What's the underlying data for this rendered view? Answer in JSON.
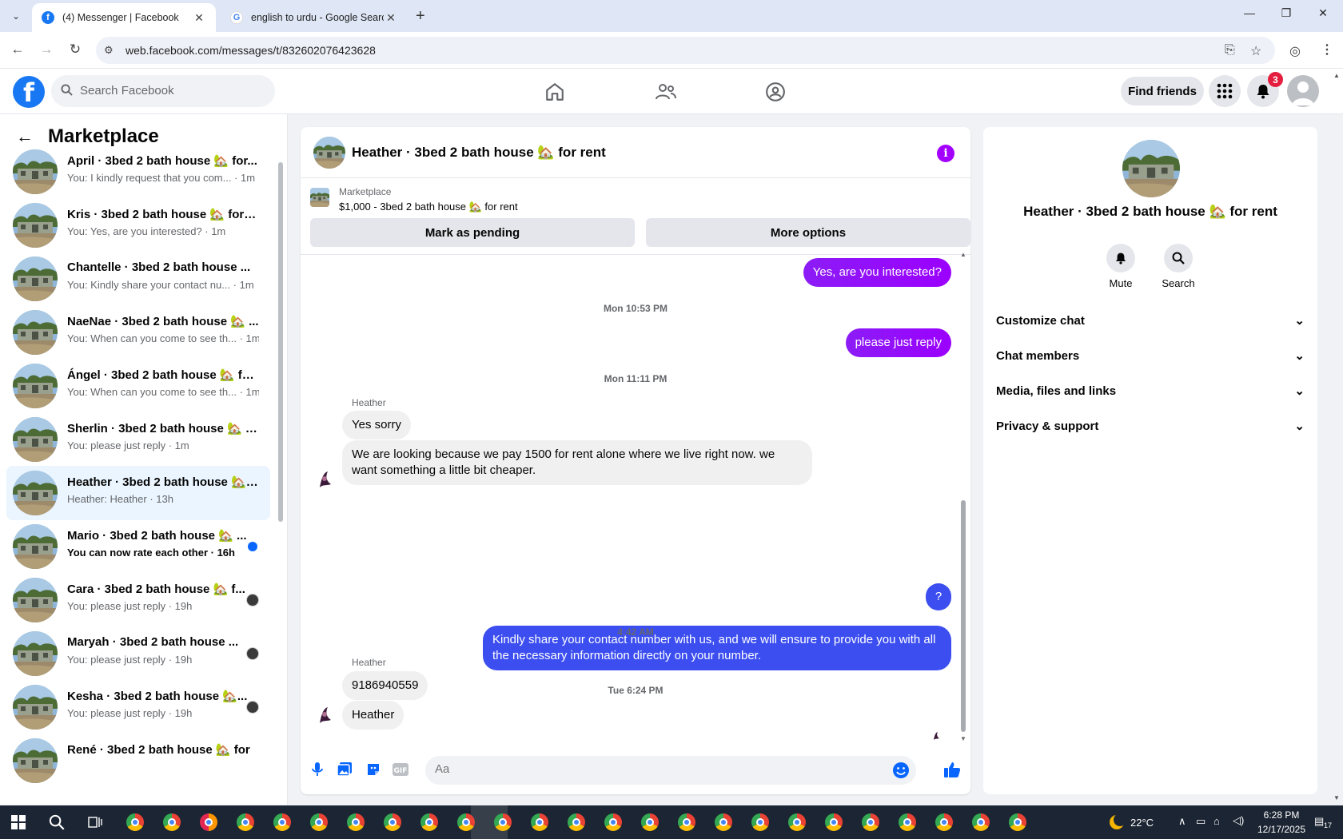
{
  "browser": {
    "tabs": [
      {
        "title": "(4) Messenger | Facebook",
        "active": true
      },
      {
        "title": "english to urdu - Google Search",
        "active": false
      }
    ],
    "url": "web.facebook.com/messages/t/832602076423628"
  },
  "fb_header": {
    "search_placeholder": "Search Facebook",
    "find_friends": "Find friends",
    "notification_count": "3"
  },
  "left": {
    "title": "Marketplace",
    "chats": [
      {
        "name": "April · 3bed 2 bath house 🏡 for...",
        "preview": "You: I kindly request that you com... · 1m"
      },
      {
        "name": "Kris · 3bed 2 bath house 🏡 for r...",
        "preview": "You: Yes, are you interested? · 1m"
      },
      {
        "name": "Chantelle · 3bed 2 bath house ...",
        "preview": "You: Kindly share your contact nu... · 1m"
      },
      {
        "name": "NaeNae · 3bed 2 bath house 🏡 ...",
        "preview": "You: When can you come to see th... · 1m"
      },
      {
        "name": "Ángel · 3bed 2 bath house 🏡 fo...",
        "preview": "You: When can you come to see th... · 1m"
      },
      {
        "name": "Sherlin · 3bed 2 bath house 🏡 f...",
        "preview": "You: please just reply · 1m"
      },
      {
        "name": "Heather · 3bed 2 bath house 🏡 ...",
        "preview": "Heather: Heather · 13h"
      },
      {
        "name": "Mario · 3bed 2 bath house 🏡 ...",
        "preview": "You can now rate each other · 16h"
      },
      {
        "name": "Cara · 3bed 2 bath house 🏡 f...",
        "preview": "You: please just reply · 19h"
      },
      {
        "name": "Maryah · 3bed 2 bath house ...",
        "preview": "You: please just reply · 19h"
      },
      {
        "name": "Kesha · 3bed 2 bath house 🏡...",
        "preview": "You: please just reply · 19h"
      },
      {
        "name": "René · 3bed 2 bath house 🏡 for",
        "preview": ""
      }
    ]
  },
  "conversation": {
    "title": "Heather · 3bed 2 bath house 🏡 for rent",
    "listing_category": "Marketplace",
    "listing_title": "$1,000 - 3bed 2 bath house 🏡 for rent",
    "mark_pending": "Mark as pending",
    "more_options": "More options",
    "messages": {
      "m1": "Yes, are you interested?",
      "ts1": "Mon 10:53 PM",
      "m2": "please just reply",
      "ts2": "Mon 11:11 PM",
      "sender1": "Heather",
      "m3": "Yes sorry",
      "m4": "We are looking because we pay 1500 for rent alone where we live right now. we want something a little bit cheaper.",
      "m5": "Kindly share your contact number with us, and we will ensure to provide you with all the necessary information directly on your number.",
      "ts3": "Tue 6:24 PM",
      "m6": "?",
      "ts4": "4:42 AM",
      "sender2": "Heather",
      "m7": "9186940559",
      "m8": "Heather"
    },
    "composer_placeholder": "Aa"
  },
  "right": {
    "title": "Heather · 3bed 2 bath house 🏡 for rent",
    "mute": "Mute",
    "search": "Search",
    "sections": [
      "Customize chat",
      "Chat members",
      "Media, files and links",
      "Privacy & support"
    ]
  },
  "taskbar": {
    "temperature": "22°C",
    "time": "6:28 PM",
    "date": "12/17/2025",
    "notif_count": "17"
  },
  "colors": {
    "facebook_blue": "#1877f2",
    "messenger_purple": "#9b00ff",
    "outgoing_blue": "#3c4ef0"
  }
}
